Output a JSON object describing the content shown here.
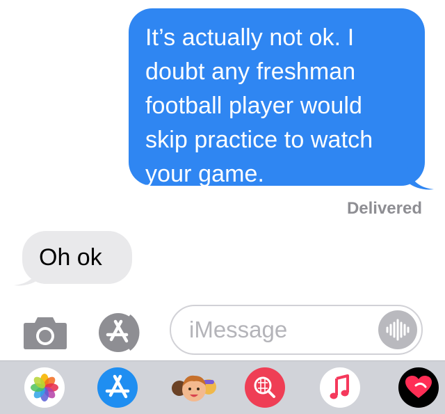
{
  "conversation": {
    "outgoing_message": "It’s actually not ok. I doubt any freshman football player would skip practice to watch your game.",
    "delivery_status": "Delivered",
    "incoming_message": "Oh ok"
  },
  "compose": {
    "placeholder": "iMessage"
  },
  "app_drawer": {
    "apps": [
      "photos-icon",
      "app-store-icon",
      "memoji-icon",
      "web-image-search-icon",
      "music-icon",
      "digital-touch-icon"
    ]
  },
  "colors": {
    "outgoing_bubble": "#2f86f2",
    "incoming_bubble": "#e9e9eb",
    "delivered_text": "#8e8e93",
    "drawer_background": "#d1d3d9"
  }
}
